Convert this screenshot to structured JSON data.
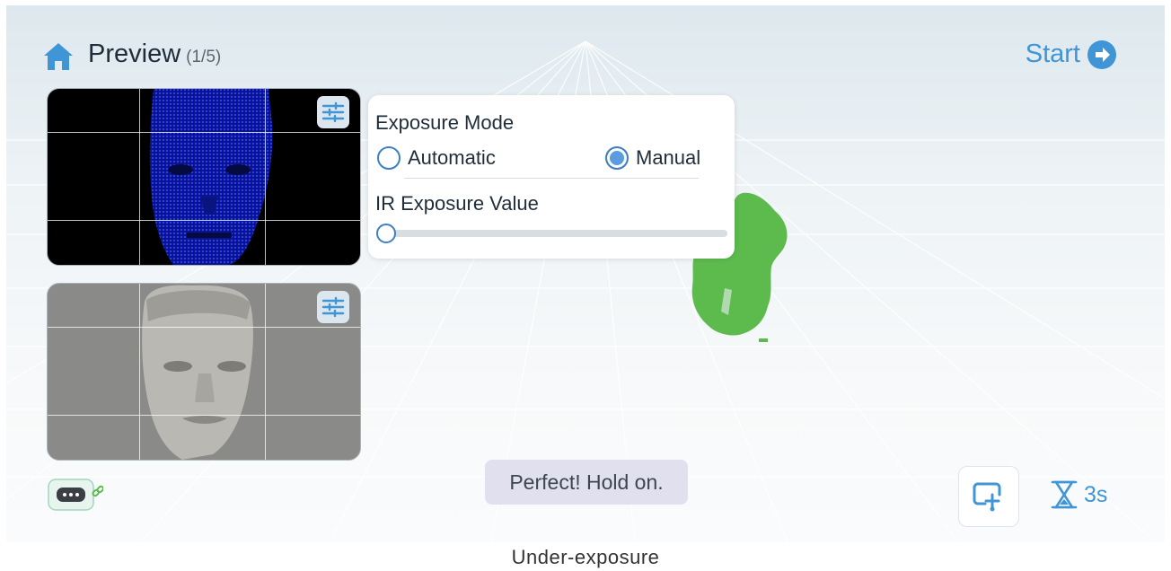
{
  "header": {
    "title": "Preview",
    "count": "(1/5)",
    "home_icon": "home-icon",
    "start_label": "Start",
    "start_icon": "arrow-right-circle-icon"
  },
  "previews": {
    "ir_camera": {
      "settings_icon": "sliders-icon"
    },
    "rgb_camera": {
      "settings_icon": "sliders-icon"
    }
  },
  "exposure_panel": {
    "mode_label": "Exposure Mode",
    "options": [
      {
        "label": "Automatic",
        "selected": false
      },
      {
        "label": "Manual",
        "selected": true
      }
    ],
    "value_label": "IR Exposure Value",
    "value_fraction": 0.0
  },
  "status": {
    "message": "Perfect! Hold on."
  },
  "bottom_bar": {
    "device_icon": "scanner-linked-icon",
    "capture_icon": "scan-capture-icon",
    "timer_icon": "hourglass-icon",
    "timer_value": "3s"
  },
  "caption": "Under-exposure",
  "colors": {
    "accent": "#3f95d6",
    "point_cloud": "#5dbb4e",
    "ir_blue": "#1a2fd6"
  }
}
